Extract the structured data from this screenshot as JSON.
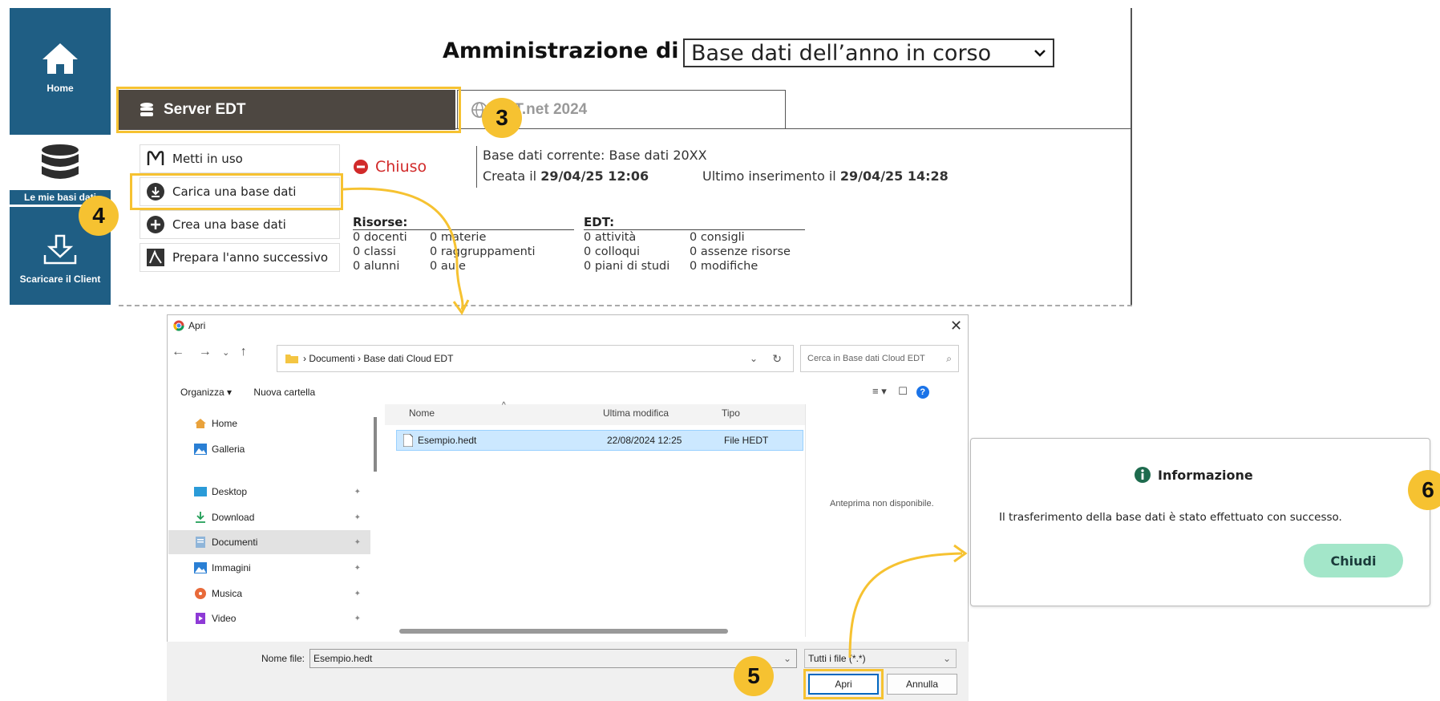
{
  "sidebar": {
    "items": [
      {
        "label": "Home",
        "icon": "home-icon"
      },
      {
        "label": "Le mie basi dati",
        "icon": "database-icon"
      },
      {
        "label": "Scaricare il Client",
        "icon": "download-icon"
      }
    ]
  },
  "admin": {
    "title": "Amministrazione di",
    "select_value": "Base dati dell’anno in corso",
    "tabs": [
      {
        "label": "Server EDT"
      },
      {
        "label": "EDT.net 2024"
      }
    ],
    "actions": [
      {
        "label": "Metti in uso"
      },
      {
        "label": "Carica una base dati"
      },
      {
        "label": "Crea una base dati"
      },
      {
        "label": "Prepara l'anno successivo"
      }
    ],
    "status": "Chiuso",
    "current_db": "Base dati corrente: Base dati 20XX",
    "created_prefix": "Creata il ",
    "created_value": "29/04/25 12:06",
    "last_prefix": "Ultimo inserimento il ",
    "last_value": "29/04/25 14:28",
    "resources": {
      "heading": "Risorse:",
      "col1": [
        "0 docenti",
        "0 classi",
        "0 alunni"
      ],
      "col2": [
        "0 materie",
        "0 raggruppamenti",
        "0 aule"
      ]
    },
    "edt": {
      "heading": "EDT:",
      "col1": [
        "0 attività",
        "0 colloqui",
        "0 piani di studi"
      ],
      "col2": [
        "0 consigli",
        "0 assenze risorse",
        "0 modifiche"
      ]
    }
  },
  "badges": {
    "b3": "3",
    "b4": "4",
    "b5": "5",
    "b6": "6"
  },
  "dialog": {
    "title": "Apri",
    "close": "✕",
    "path": [
      "Documenti",
      "Base dati Cloud EDT"
    ],
    "search_placeholder": "Cerca in Base dati Cloud EDT",
    "organize": "Organizza ▾",
    "new_folder": "Nuova cartella",
    "nav_items": [
      {
        "label": "Home"
      },
      {
        "label": "Galleria"
      },
      {
        "label": "Desktop"
      },
      {
        "label": "Download"
      },
      {
        "label": "Documenti"
      },
      {
        "label": "Immagini"
      },
      {
        "label": "Musica"
      },
      {
        "label": "Video"
      }
    ],
    "columns": [
      "Nome",
      "Ultima modifica",
      "Tipo"
    ],
    "file": {
      "name": "Esempio.hedt",
      "modified": "22/08/2024 12:25",
      "type": "File HEDT"
    },
    "preview_text": "Anteprima non disponibile.",
    "filename_label": "Nome file:",
    "filename_value": "Esempio.hedt",
    "filter_value": "Tutti i file (*.*)",
    "open_button": "Apri",
    "cancel_button": "Annulla"
  },
  "info": {
    "title": "Informazione",
    "message": "Il trasferimento della base dati è stato effettuato con successo.",
    "close_button": "Chiudi"
  },
  "colors": {
    "sidebar": "#1f5e84",
    "highlight": "#f6c231",
    "tab_active": "#4d4741",
    "closed": "#d12a2a",
    "chiudi": "#a3e6c9"
  }
}
